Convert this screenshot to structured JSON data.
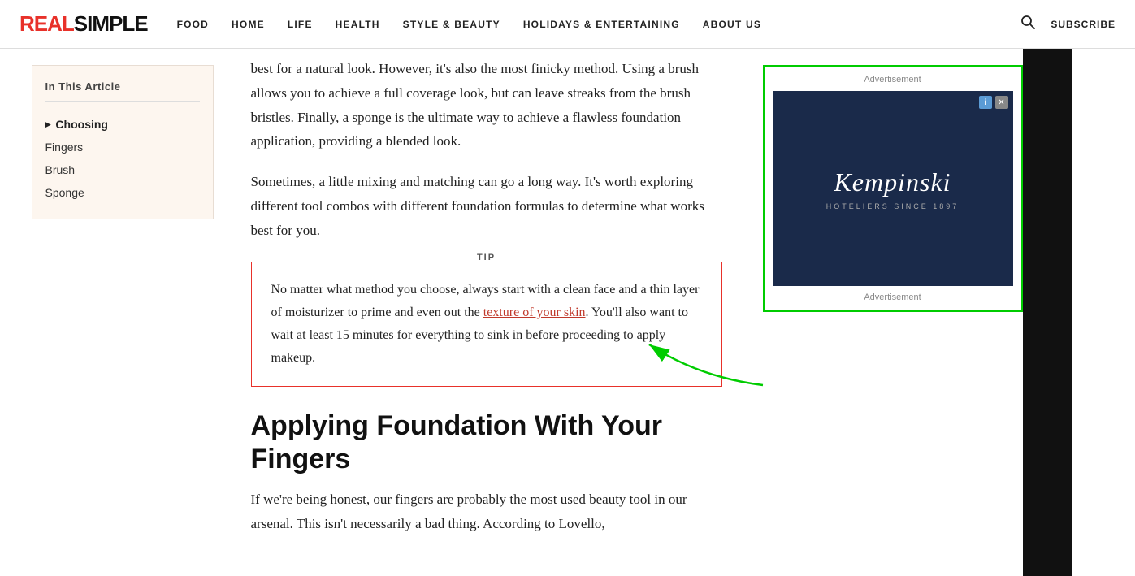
{
  "site": {
    "logo_part1": "REAL",
    "logo_part2": "SIMPLE"
  },
  "nav": {
    "links": [
      {
        "label": "FOOD",
        "id": "food"
      },
      {
        "label": "HOME",
        "id": "home"
      },
      {
        "label": "LIFE",
        "id": "life"
      },
      {
        "label": "HEALTH",
        "id": "health"
      },
      {
        "label": "STYLE & BEAUTY",
        "id": "style-beauty"
      },
      {
        "label": "HOLIDAYS & ENTERTAINING",
        "id": "holidays"
      },
      {
        "label": "ABOUT US",
        "id": "about-us"
      }
    ],
    "subscribe_label": "SUBSCRIBE"
  },
  "sidebar": {
    "title": "In This Article",
    "items": [
      {
        "label": "Choosing",
        "active": true
      },
      {
        "label": "Fingers",
        "active": false
      },
      {
        "label": "Brush",
        "active": false
      },
      {
        "label": "Sponge",
        "active": false
      }
    ]
  },
  "article": {
    "intro_text": "best for a natural look. However, it's also the most finicky method. Using a brush allows you to achieve a full coverage look, but can leave streaks from the brush bristles. Finally, a sponge is the ultimate way to achieve a flawless foundation application, providing a blended look.",
    "mixing_text": "Sometimes, a little mixing and matching can go a long way. It's worth exploring different tool combos with different foundation formulas to determine what works best for you.",
    "tip_label": "TIP",
    "tip_text": "No matter what method you choose, always start with a clean face and a thin layer of moisturizer to prime and even out the ",
    "tip_link_text": "texture of your skin",
    "tip_text2": ". You'll also want to wait at least 15 minutes for everything to sink in before proceeding to apply makeup.",
    "section_heading_line1": "Applying Foundation With Your",
    "section_heading_line2": "Fingers",
    "fingers_text": "If we're being honest, our fingers are probably the most used beauty tool in our arsenal. This isn't necessarily a bad thing. According to Lovello,"
  },
  "ad": {
    "label_top": "Advertisement",
    "brand_name": "Kempinski",
    "tagline": "HOTELIERS SINCE 1897",
    "label_bottom": "Advertisement"
  }
}
